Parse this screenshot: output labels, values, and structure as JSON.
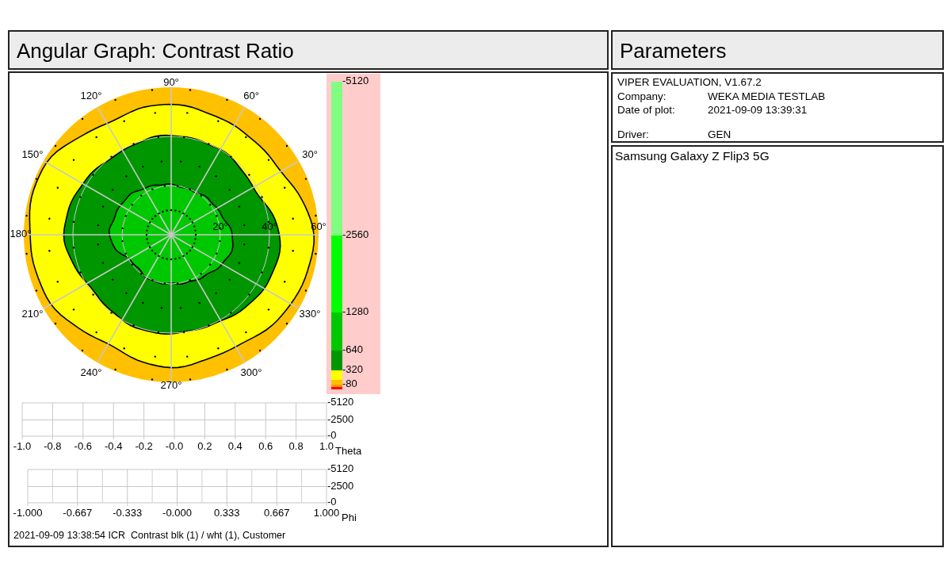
{
  "graph_panel": {
    "title": "Angular Graph: Contrast Ratio",
    "polar_plot": {
      "angle_labels": [
        "30°",
        "60°",
        "90°",
        "120°",
        "150°",
        "180°",
        "210°",
        "240°",
        "270°",
        "300°",
        "330°"
      ],
      "radial_labels": [
        "20°",
        "40°",
        "60°"
      ]
    },
    "color_scale": {
      "bands": [
        {
          "label": "-5120",
          "color": "#80ff80"
        },
        {
          "label": "-2560",
          "color": "#00ff00"
        },
        {
          "label": "-1280",
          "color": "#00c800"
        },
        {
          "label": "-640",
          "color": "#009600"
        },
        {
          "label": "-320",
          "color": "#ffff00"
        },
        {
          "color": "#ffc000"
        },
        {
          "label": "-80",
          "color": "#ff9900"
        },
        {
          "color": "#ff0000"
        }
      ]
    },
    "theta_chart": {
      "chart_data": {
        "type": "line",
        "xlabel": "Theta",
        "xlim": [
          -1,
          1
        ],
        "ylim": [
          0,
          -5120
        ],
        "grid": true,
        "xticks": [
          {
            "value": -1,
            "label": "-1.0"
          },
          {
            "value": -0.8,
            "label": "-0.8"
          },
          {
            "value": -0.6,
            "label": "-0.6"
          },
          {
            "value": -0.4,
            "label": "-0.4"
          },
          {
            "value": -0.2,
            "label": "-0.2"
          },
          {
            "value": 0,
            "label": "-0.0"
          },
          {
            "value": 0.2,
            "label": "0.2"
          },
          {
            "value": 0.4,
            "label": "0.4"
          },
          {
            "value": 0.6,
            "label": "0.6"
          },
          {
            "value": 0.8,
            "label": "0.8"
          },
          {
            "value": 1,
            "label": "1.0"
          }
        ],
        "yticks": [
          -5120,
          -2500,
          {
            "value": 0,
            "label": "-0"
          }
        ]
      }
    },
    "phi_chart": {
      "chart_data": {
        "type": "line",
        "xlabel": "Phi",
        "xlim": [
          -1,
          1
        ],
        "ylim": [
          0,
          -5120
        ],
        "grid": true,
        "xticks": [
          {
            "value": -1,
            "label": "-1.000"
          },
          {
            "value": -0.667,
            "label": "-0.667"
          },
          {
            "value": -0.333,
            "label": "-0.333"
          },
          {
            "value": 0,
            "label": "-0.000"
          },
          {
            "value": 0.333,
            "label": "0.333"
          },
          {
            "value": 0.667,
            "label": "0.667"
          },
          {
            "value": 1,
            "label": "1.000"
          }
        ],
        "yticks": [
          -5120,
          -2500,
          {
            "value": 0,
            "label": "-0"
          }
        ]
      }
    },
    "footer": "2021-09-09 13:38:54 ICR  Contrast blk (1) / wht (1), Customer"
  },
  "parameters_panel": {
    "title": "Parameters",
    "software": "VIPER EVALUATION, V1.67.2",
    "fields": [
      {
        "label": "Company:",
        "value": "WEKA MEDIA TESTLAB"
      },
      {
        "label": "Date of plot:",
        "value": "2021-09-09 13:39:31"
      },
      {
        "label": "Driver:",
        "value": "GEN"
      }
    ],
    "device": "Samsung Galaxy Z Flip3 5G"
  }
}
